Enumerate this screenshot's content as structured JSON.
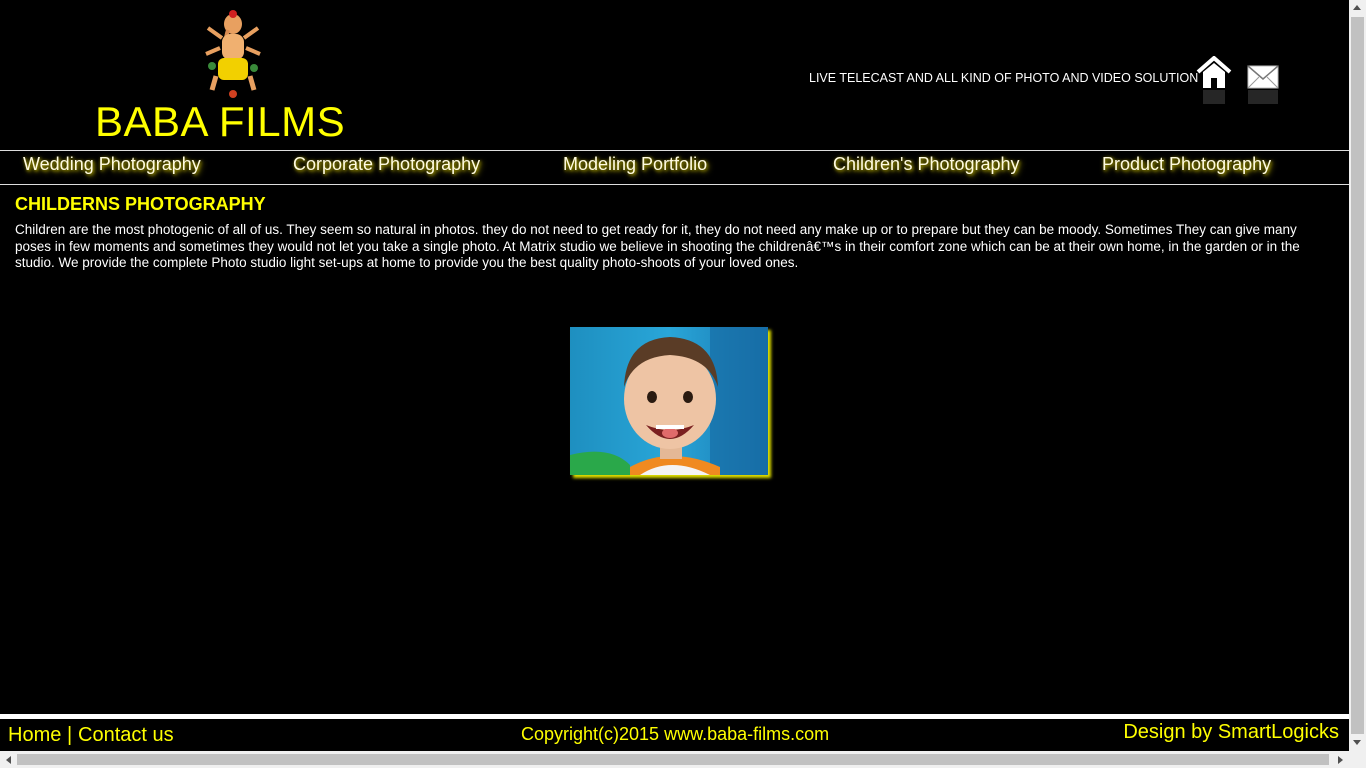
{
  "header": {
    "site_title": "BABA FILMS",
    "tagline": "LIVE TELECAST AND ALL KIND OF PHOTO AND VIDEO SOLUTION",
    "logo_icon": "ganesha-figure",
    "home_icon": "home-icon",
    "mail_icon": "mail-icon"
  },
  "nav": {
    "items": [
      {
        "label": "Wedding Photography"
      },
      {
        "label": "Corporate Photography"
      },
      {
        "label": "Modeling Portfolio"
      },
      {
        "label": "Children's Photography"
      },
      {
        "label": "Product Photography"
      }
    ]
  },
  "content": {
    "heading": "CHILDERNS PHOTOGRAPHY",
    "body": "Children are the most photogenic of all of us. They seem so natural in photos. they do not need to get ready for it, they do not need any make up or to prepare but they can be moody. Sometimes They can give many poses in few moments and sometimes they would not let you take a single photo. At Matrix studio we believe in shooting the childrenâ€™s in their comfort zone which can be at their own home, in the garden or in the studio. We provide the complete Photo studio light set-ups at home to provide you the best quality photo-shoots of your loved ones."
  },
  "footer": {
    "home_label": "Home",
    "separator": "|",
    "contact_label": "Contact us",
    "copyright": "Copyright(c)2015 www.baba-films.com",
    "design_credit": "Design by SmartLogicks"
  },
  "colors": {
    "background": "#000000",
    "accent": "#ffff00",
    "nav_glow": "#b4a800"
  }
}
